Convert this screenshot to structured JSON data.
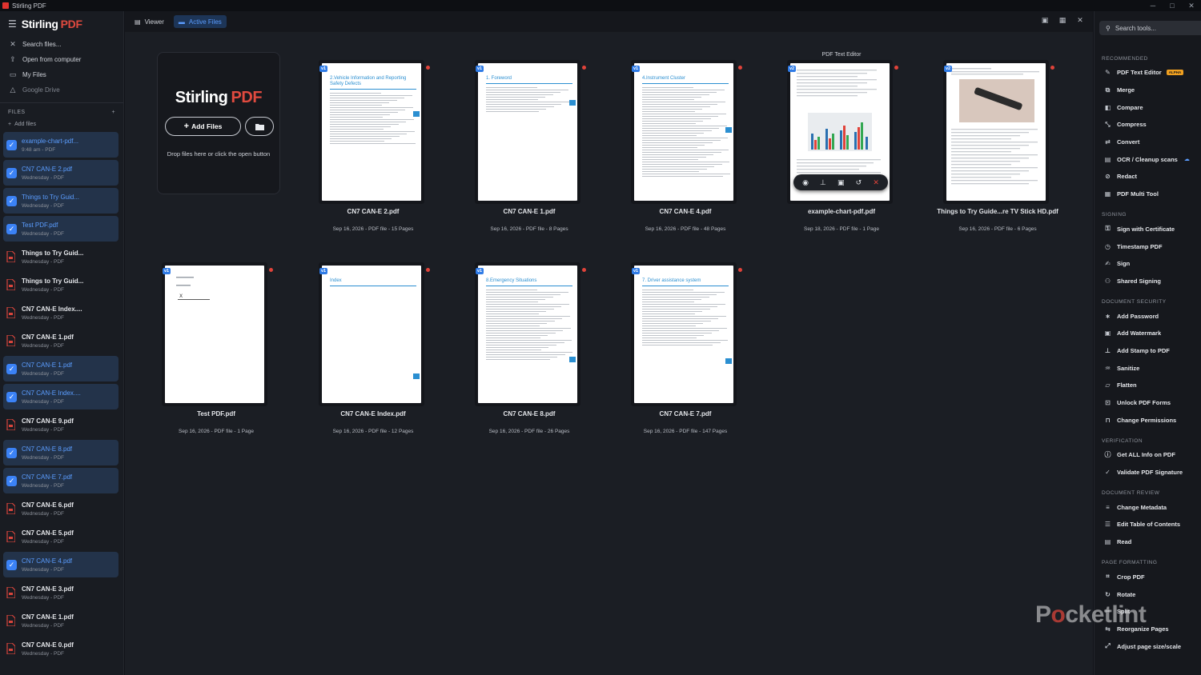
{
  "window": {
    "title": "Stirling PDF"
  },
  "brand": {
    "name": "Stirling",
    "suffix": "PDF"
  },
  "sidebar": {
    "search_placeholder": "Search files...",
    "items": [
      {
        "label": "Open from computer",
        "icon": "upload-icon"
      },
      {
        "label": "My Files",
        "icon": "folder-icon"
      },
      {
        "label": "Google Drive",
        "icon": "drive-icon"
      }
    ],
    "files_heading": "FILES",
    "add_files": "Add files",
    "files": [
      {
        "name": "example-chart-pdf...",
        "sub": "9:48 am - PDF",
        "selected": true
      },
      {
        "name": "CN7 CAN-E 2.pdf",
        "sub": "Wednesday - PDF",
        "selected": true
      },
      {
        "name": "Things to Try Guid...",
        "sub": "Wednesday - PDF",
        "selected": true
      },
      {
        "name": "Test PDF.pdf",
        "sub": "Wednesday - PDF",
        "selected": true
      },
      {
        "name": "Things to Try Guid...",
        "sub": "Wednesday - PDF",
        "selected": false
      },
      {
        "name": "Things to Try Guid...",
        "sub": "Wednesday - PDF",
        "selected": false
      },
      {
        "name": "CN7 CAN-E Index....",
        "sub": "Wednesday - PDF",
        "selected": false
      },
      {
        "name": "CN7 CAN-E 1.pdf",
        "sub": "Wednesday - PDF",
        "selected": false
      },
      {
        "name": "CN7 CAN-E 1.pdf",
        "sub": "Wednesday - PDF",
        "selected": true
      },
      {
        "name": "CN7 CAN-E Index....",
        "sub": "Wednesday - PDF",
        "selected": true
      },
      {
        "name": "CN7 CAN-E 9.pdf",
        "sub": "Wednesday - PDF",
        "selected": false
      },
      {
        "name": "CN7 CAN-E 8.pdf",
        "sub": "Wednesday - PDF",
        "selected": true
      },
      {
        "name": "CN7 CAN-E 7.pdf",
        "sub": "Wednesday - PDF",
        "selected": true
      },
      {
        "name": "CN7 CAN-E 6.pdf",
        "sub": "Wednesday - PDF",
        "selected": false
      },
      {
        "name": "CN7 CAN-E 5.pdf",
        "sub": "Wednesday - PDF",
        "selected": false
      },
      {
        "name": "CN7 CAN-E 4.pdf",
        "sub": "Wednesday - PDF",
        "selected": true
      },
      {
        "name": "CN7 CAN-E 3.pdf",
        "sub": "Wednesday - PDF",
        "selected": false
      },
      {
        "name": "CN7 CAN-E 1.pdf",
        "sub": "Wednesday - PDF",
        "selected": false
      },
      {
        "name": "CN7 CAN-E 0.pdf",
        "sub": "Wednesday - PDF",
        "selected": false
      }
    ]
  },
  "toolbar": {
    "viewer": "Viewer",
    "active_files": "Active Files"
  },
  "dropzone": {
    "add_files": "Add Files",
    "hint": "Drop files here or click the open button"
  },
  "cards": [
    {
      "name": "CN7 CAN-E 2.pdf",
      "meta": "Sep 16, 2026 - PDF file - 15 Pages",
      "version": "v1",
      "heading": "2.Vehicle Information and Reporting Safety Defects"
    },
    {
      "name": "CN7 CAN-E 1.pdf",
      "meta": "Sep 16, 2026 - PDF file - 8 Pages",
      "version": "v1",
      "heading": "1. Foreword"
    },
    {
      "name": "CN7 CAN-E 4.pdf",
      "meta": "Sep 16, 2026 - PDF file - 48 Pages",
      "version": "v1",
      "heading": "4.Instrument Cluster"
    },
    {
      "name": "example-chart-pdf.pdf",
      "meta": "Sep 18, 2026 - PDF file - 1 Page",
      "version": "v2",
      "heading": "",
      "hover_label": "PDF Text Editor"
    },
    {
      "name": "Things to Try Guide...re TV Stick HD.pdf",
      "meta": "Sep 16, 2026 - PDF file - 6 Pages",
      "version": "v2",
      "heading": ""
    },
    {
      "name": "Test PDF.pdf",
      "meta": "Sep 16, 2026 - PDF file - 1 Page",
      "version": "v1",
      "heading": ""
    },
    {
      "name": "CN7 CAN-E Index.pdf",
      "meta": "Sep 16, 2026 - PDF file - 12 Pages",
      "version": "v1",
      "heading": "Index"
    },
    {
      "name": "CN7 CAN-E 8.pdf",
      "meta": "Sep 16, 2026 - PDF file - 26 Pages",
      "version": "v1",
      "heading": "8.Emergency Situations"
    },
    {
      "name": "CN7 CAN-E 7.pdf",
      "meta": "Sep 16, 2026 - PDF file - 147 Pages",
      "version": "v1",
      "heading": "7. Driver assistance system"
    }
  ],
  "tools_panel": {
    "search_placeholder": "Search tools...",
    "sections": [
      {
        "title": "RECOMMENDED",
        "tools": [
          {
            "label": "PDF Text Editor",
            "icon": "edit-icon",
            "badge": "ALPHA"
          },
          {
            "label": "Merge",
            "icon": "merge-icon"
          },
          {
            "label": "Compare",
            "icon": "compare-icon"
          },
          {
            "label": "Compress",
            "icon": "compress-icon"
          },
          {
            "label": "Convert",
            "icon": "convert-icon"
          },
          {
            "label": "OCR / Cleanup scans",
            "icon": "ocr-icon",
            "cloud": true
          },
          {
            "label": "Redact",
            "icon": "redact-icon"
          },
          {
            "label": "PDF Multi Tool",
            "icon": "multitool-icon"
          }
        ]
      },
      {
        "title": "SIGNING",
        "tools": [
          {
            "label": "Sign with Certificate",
            "icon": "certificate-icon"
          },
          {
            "label": "Timestamp PDF",
            "icon": "clock-icon"
          },
          {
            "label": "Sign",
            "icon": "sign-icon"
          },
          {
            "label": "Shared Signing",
            "icon": "users-icon"
          }
        ]
      },
      {
        "title": "DOCUMENT SECURITY",
        "tools": [
          {
            "label": "Add Password",
            "icon": "password-icon"
          },
          {
            "label": "Add Watermark",
            "icon": "watermark-icon"
          },
          {
            "label": "Add Stamp to PDF",
            "icon": "stamp-icon"
          },
          {
            "label": "Sanitize",
            "icon": "sanitize-icon"
          },
          {
            "label": "Flatten",
            "icon": "flatten-icon"
          },
          {
            "label": "Unlock PDF Forms",
            "icon": "unlock-icon"
          },
          {
            "label": "Change Permissions",
            "icon": "lock-icon"
          }
        ]
      },
      {
        "title": "VERIFICATION",
        "tools": [
          {
            "label": "Get ALL Info on PDF",
            "icon": "info-icon"
          },
          {
            "label": "Validate PDF Signature",
            "icon": "validate-icon"
          }
        ]
      },
      {
        "title": "DOCUMENT REVIEW",
        "tools": [
          {
            "label": "Change Metadata",
            "icon": "metadata-icon"
          },
          {
            "label": "Edit Table of Contents",
            "icon": "toc-icon"
          },
          {
            "label": "Read",
            "icon": "read-icon"
          }
        ]
      },
      {
        "title": "PAGE FORMATTING",
        "tools": [
          {
            "label": "Crop PDF",
            "icon": "crop-icon"
          },
          {
            "label": "Rotate",
            "icon": "rotate-icon"
          },
          {
            "label": "Split",
            "icon": "split-icon"
          },
          {
            "label": "Reorganize Pages",
            "icon": "reorganize-icon"
          },
          {
            "label": "Adjust page size/scale",
            "icon": "scale-icon"
          }
        ]
      }
    ]
  },
  "watermark": {
    "pre": "P",
    "o": "o",
    "post": "cketlint"
  },
  "colors": {
    "accent": "#3b82f6",
    "brand_red": "#e04a3f",
    "badge": "#f0a020"
  }
}
